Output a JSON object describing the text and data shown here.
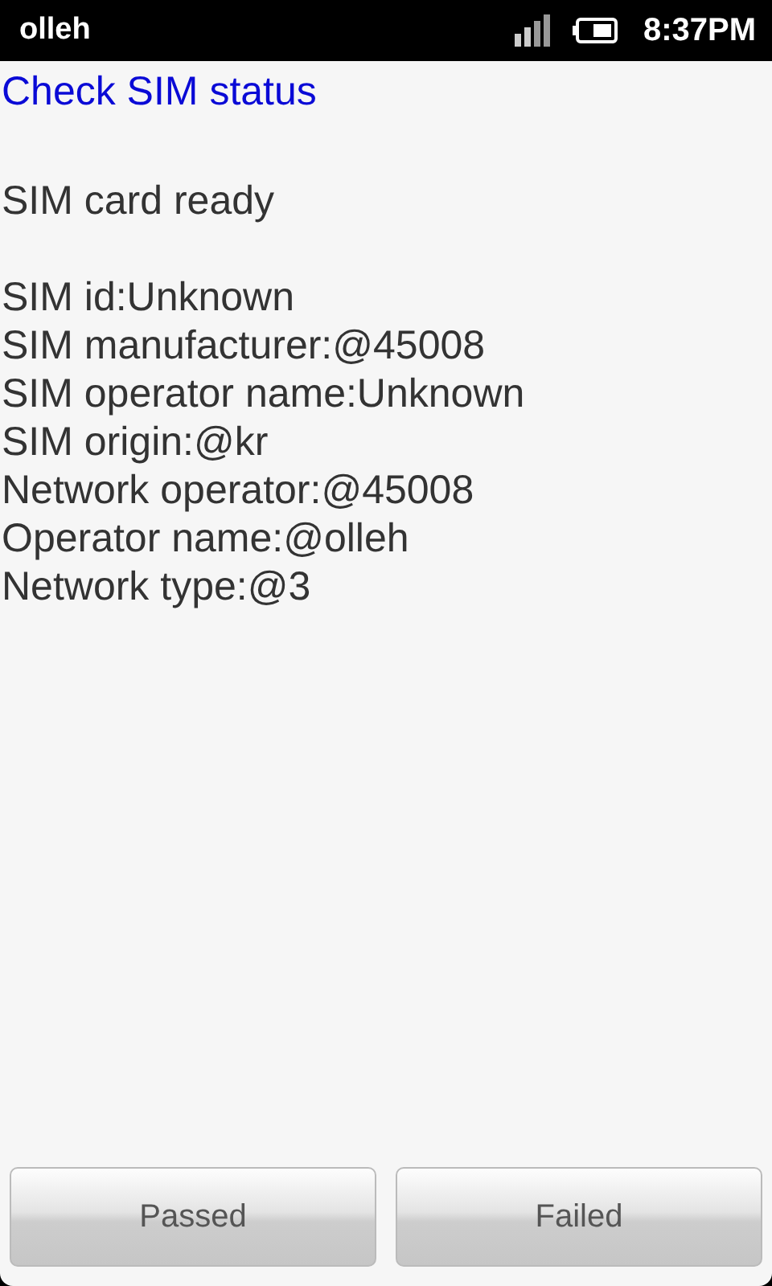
{
  "status_bar": {
    "carrier": "olleh",
    "time": "8:37PM"
  },
  "title": "Check SIM status",
  "status": "SIM card ready",
  "details": [
    "SIM id:Unknown",
    "SIM manufacturer:@45008",
    "SIM operator name:Unknown",
    "SIM origin:@kr",
    "Network operator:@45008",
    "Operator name:@olleh",
    "Network type:@3"
  ],
  "buttons": [
    "Passed",
    "Failed"
  ]
}
